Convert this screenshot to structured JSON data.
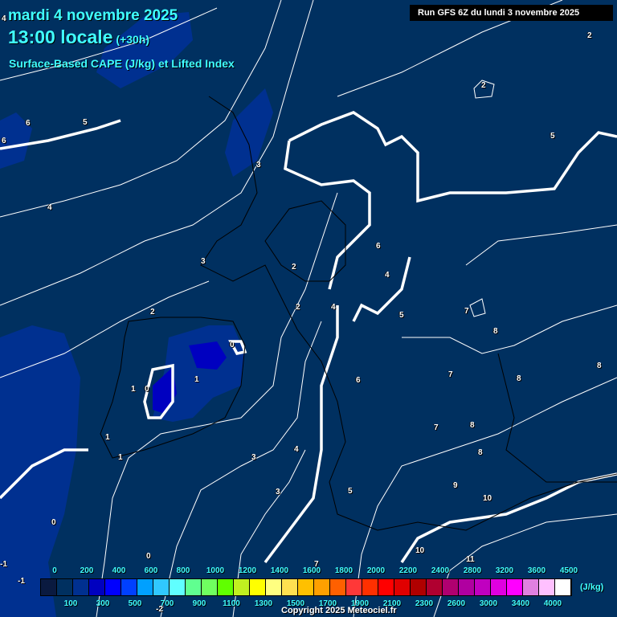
{
  "header": {
    "date": "mardi 4 novembre 2025",
    "time": "13:00 locale",
    "lead": "(+30h)",
    "title": "Surface-Based CAPE (J/kg) et Lifted Index",
    "run": "Run GFS 6Z du lundi 3 novembre 2025"
  },
  "map": {
    "background_color": "#003060",
    "contour_color": "#ffffff",
    "lifted_index_labels": [
      "4",
      "2",
      "2",
      "6",
      "5",
      "6",
      "5",
      "3",
      "4",
      "3",
      "2",
      "6",
      "4",
      "2",
      "4",
      "2",
      "5",
      "7",
      "8",
      "0",
      "8",
      "1",
      "0",
      "1",
      "6",
      "7",
      "8",
      "7",
      "8",
      "1",
      "1",
      "3",
      "4",
      "8",
      "9",
      "3",
      "5",
      "10",
      "0",
      "10",
      "0",
      "11",
      "-1",
      "7",
      "-1",
      "-2"
    ]
  },
  "legend": {
    "unit": "(J/kg)",
    "top_labels": [
      "0",
      "200",
      "400",
      "600",
      "800",
      "1000",
      "1200",
      "1400",
      "1600",
      "1800",
      "2000",
      "2200",
      "2400",
      "2800",
      "3200",
      "3600",
      "4500"
    ],
    "bottom_labels": [
      "100",
      "300",
      "500",
      "700",
      "900",
      "1100",
      "1300",
      "1500",
      "1700",
      "1900",
      "2100",
      "2300",
      "2600",
      "3000",
      "3400",
      "4000"
    ],
    "colors": [
      "#0a1a40",
      "#003060",
      "#003090",
      "#0000c0",
      "#0000ff",
      "#0040ff",
      "#00a0ff",
      "#30c8ff",
      "#60ffff",
      "#60ff90",
      "#70ff60",
      "#60ff00",
      "#c0f020",
      "#ffff00",
      "#ffff80",
      "#ffe050",
      "#ffc000",
      "#ffa000",
      "#ff6000",
      "#ff3838",
      "#ff3000",
      "#ff0000",
      "#e00000",
      "#b00000",
      "#b00030",
      "#b00070",
      "#b000a0",
      "#c000c0",
      "#e000e0",
      "#ff00ff",
      "#e080e0",
      "#ffc0ff",
      "#ffffff"
    ]
  },
  "footer": {
    "copyright": "Copyright 2025 Meteociel.fr"
  }
}
